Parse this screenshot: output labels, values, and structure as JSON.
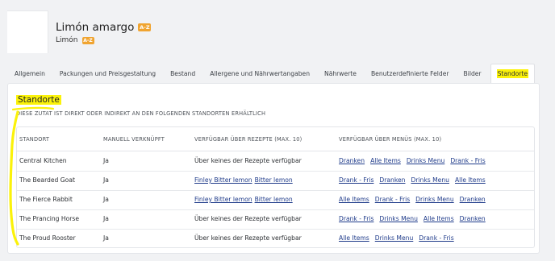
{
  "header": {
    "title": "Limón amargo",
    "subtitle": "Limón",
    "badge": "A-Z"
  },
  "tabs": [
    {
      "label": "Allgemein"
    },
    {
      "label": "Packungen und Preisgestaltung"
    },
    {
      "label": "Bestand"
    },
    {
      "label": "Allergene und Nährwertangaben"
    },
    {
      "label": "Nährwerte"
    },
    {
      "label": "Benutzerdefinierte Felder"
    },
    {
      "label": "Bilder"
    },
    {
      "label": "Standorte",
      "active": true
    }
  ],
  "section": {
    "title": "Standorte",
    "description": "DIESE ZUTAT IST DIREKT ODER INDIREKT AN DEN FOLGENDEN STANDORTEN ERHÄLTLICH"
  },
  "table": {
    "columns": [
      "STANDORT",
      "MANUELL VERKNÜPFT",
      "VERFÜGBAR ÜBER REZEPTE (MAX. 10)",
      "VERFÜGBAR ÜBER MENÜS (MAX. 10)"
    ],
    "rows": [
      {
        "location": "Central Kitchen",
        "manual": "Ja",
        "recipes_text": "Über keines der Rezepte verfügbar",
        "recipes": [],
        "menus": [
          "Dranken",
          "Alle Items",
          "Drinks Menu",
          "Drank - Fris"
        ]
      },
      {
        "location": "The Bearded Goat",
        "manual": "Ja",
        "recipes_text": "",
        "recipes": [
          "Finley Bitter lemon",
          "Bitter lemon"
        ],
        "menus": [
          "Drank - Fris",
          "Dranken",
          "Drinks Menu",
          "Alle Items"
        ]
      },
      {
        "location": "The Fierce Rabbit",
        "manual": "Ja",
        "recipes_text": "",
        "recipes": [
          "Finley Bitter lemon",
          "Bitter lemon"
        ],
        "menus": [
          "Alle Items",
          "Drank - Fris",
          "Drinks Menu",
          "Dranken"
        ]
      },
      {
        "location": "The Prancing Horse",
        "manual": "Ja",
        "recipes_text": "Über keines der Rezepte verfügbar",
        "recipes": [],
        "menus": [
          "Drank - Fris",
          "Drinks Menu",
          "Alle Items",
          "Dranken"
        ]
      },
      {
        "location": "The Proud Rooster",
        "manual": "Ja",
        "recipes_text": "Über keines der Rezepte verfügbar",
        "recipes": [],
        "menus": [
          "Alle Items",
          "Drinks Menu",
          "Drank - Fris"
        ]
      }
    ]
  },
  "colors": {
    "highlight": "#fbf20a",
    "badge": "#f0a430",
    "link": "#1f3b8a",
    "background": "#f1f2f4"
  }
}
